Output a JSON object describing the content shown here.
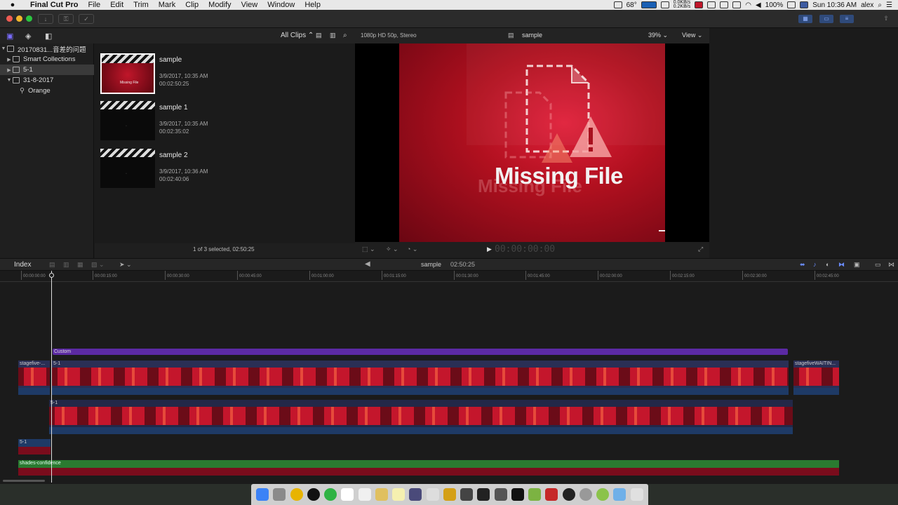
{
  "menubar": {
    "items": [
      "Final Cut Pro",
      "File",
      "Edit",
      "Trim",
      "Mark",
      "Clip",
      "Modify",
      "View",
      "Window",
      "Help"
    ],
    "temperature": "68°",
    "net_up": "0.0KB/s",
    "net_down": "0.2KB/s",
    "battery": "100%",
    "clock": "Sun 10:36 AM",
    "user": "alex"
  },
  "library": {
    "filter": "All Clips",
    "items": [
      {
        "label": "20170831...音差的问题",
        "expanded": true
      },
      {
        "label": "Smart Collections",
        "expanded": false
      },
      {
        "label": "5-1",
        "expanded": false,
        "selected": true
      },
      {
        "label": "31-8-2017",
        "expanded": true
      },
      {
        "label": "Orange"
      }
    ]
  },
  "browser": {
    "clips": [
      {
        "name": "sample",
        "date": "3/9/2017, 10:35 AM",
        "duration": "00:02:50:25",
        "thumb_text": "Missing File"
      },
      {
        "name": "sample 1",
        "date": "3/9/2017, 10:35 AM",
        "duration": "00:02:35:02"
      },
      {
        "name": "sample 2",
        "date": "3/9/2017, 10:36 AM",
        "duration": "00:02:40:06"
      }
    ],
    "footer": "1 of 3 selected, 02:50:25"
  },
  "viewer": {
    "format": "1080p HD 50p, Stereo",
    "title": "sample",
    "zoom": "39%",
    "view_menu": "View",
    "message": "Missing File",
    "timecode": "00:00:00:00"
  },
  "timeline": {
    "index_label": "Index",
    "project_name": "sample",
    "project_duration": "02:50:25",
    "ruler": [
      "00:00:00:00",
      "00:00:15:00",
      "00:00:30:00",
      "00:00:45:00",
      "00:01:00:00",
      "00:01:15:00",
      "00:01:30:00",
      "00:01:45:00",
      "00:02:00:00",
      "00:02:15:00",
      "00:02:30:00",
      "00:02:45:00"
    ],
    "tracks": {
      "custom_role": "Custom",
      "left_clip": "stagefive-...",
      "main_clip": "5-1",
      "right_clip": "stagefiveWAITIN...",
      "second_clip": "5-1",
      "short_clip": "5-1",
      "music": "shades-confidence"
    }
  }
}
